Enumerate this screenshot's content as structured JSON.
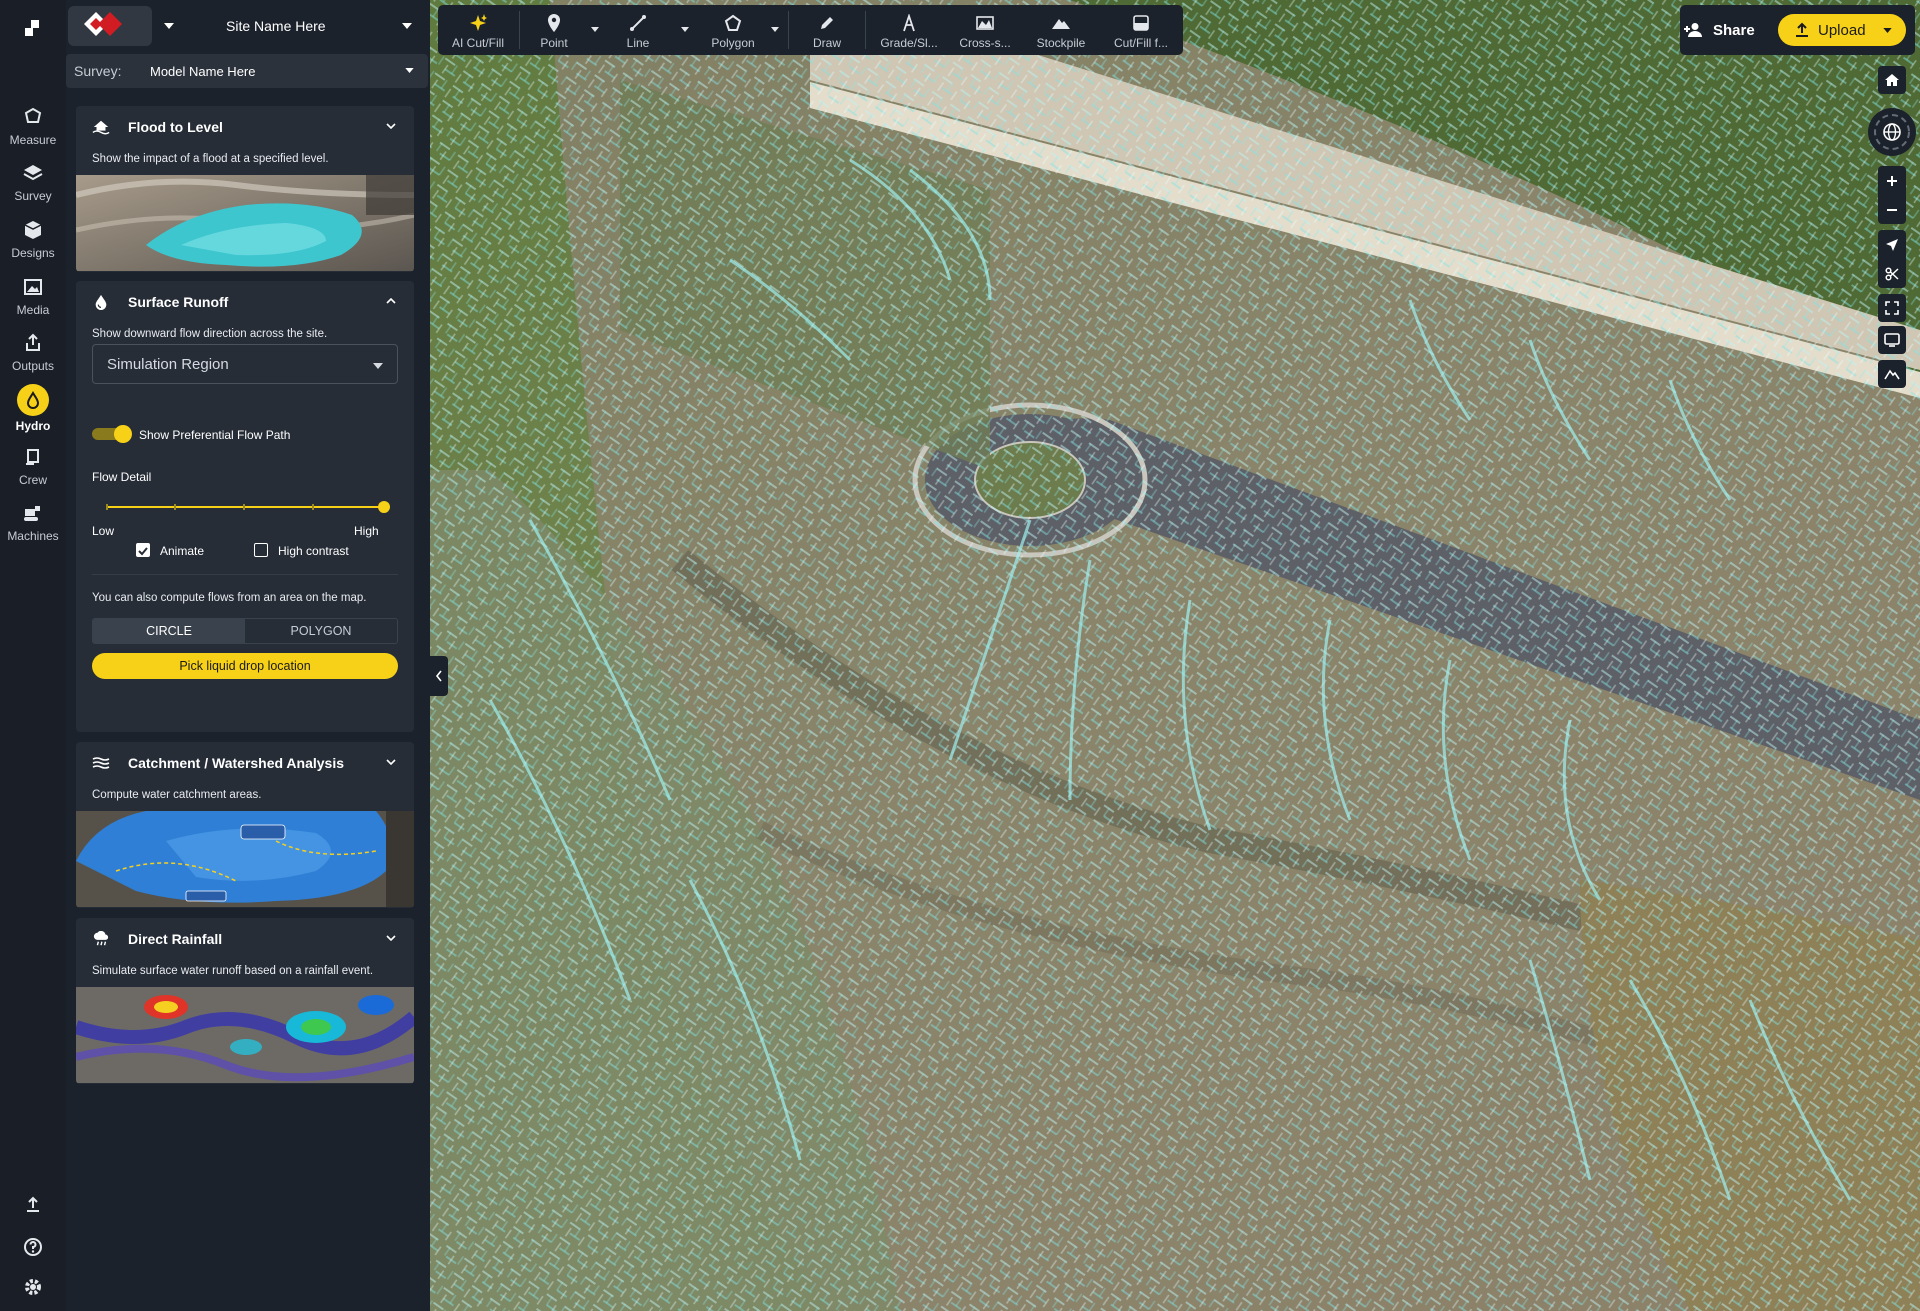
{
  "rail": {
    "items": [
      {
        "label": "Measure",
        "icon": "measure-icon"
      },
      {
        "label": "Survey",
        "icon": "layers-icon"
      },
      {
        "label": "Designs",
        "icon": "cube-icon"
      },
      {
        "label": "Media",
        "icon": "image-icon"
      },
      {
        "label": "Outputs",
        "icon": "export-icon"
      },
      {
        "label": "Hydro",
        "icon": "water-drop-icon",
        "active": true
      },
      {
        "label": "Crew",
        "icon": "crew-icon"
      },
      {
        "label": "Machines",
        "icon": "machine-icon"
      }
    ]
  },
  "header": {
    "site": "Site Name Here",
    "survey_label": "Survey:",
    "survey_value": "Model Name Here"
  },
  "cards": {
    "flood": {
      "title": "Flood to Level",
      "desc": "Show the impact of a flood at a specified level."
    },
    "runoff": {
      "title": "Surface Runoff",
      "desc": "Show downward flow direction across the site.",
      "region": "Simulation Region",
      "toggle_label": "Show Preferential Flow Path",
      "toggle_on": true,
      "flow_detail_label": "Flow Detail",
      "flow_detail_value": 1.0,
      "low": "Low",
      "high": "High",
      "animate": "Animate",
      "animate_checked": true,
      "high_contrast": "High contrast",
      "high_contrast_checked": false,
      "also": "You can also compute flows from an area on the map.",
      "seg_circle": "CIRCLE",
      "seg_polygon": "POLYGON",
      "pick": "Pick liquid drop location"
    },
    "catchment": {
      "title": "Catchment / Watershed Analysis",
      "desc": "Compute water catchment areas."
    },
    "rainfall": {
      "title": "Direct Rainfall",
      "desc": "Simulate surface water runoff based on a rainfall event."
    }
  },
  "toolbar": {
    "items": [
      {
        "label": "AI Cut/Fill",
        "icon": "sparkle-icon"
      },
      {
        "label": "Point",
        "icon": "pin-icon"
      },
      {
        "label": "Line",
        "icon": "line-icon"
      },
      {
        "label": "Polygon",
        "icon": "polygon-icon"
      },
      {
        "label": "Draw",
        "icon": "pencil-icon"
      },
      {
        "label": "Grade/Sl...",
        "icon": "grade-icon"
      },
      {
        "label": "Cross-s...",
        "icon": "cross-section-icon"
      },
      {
        "label": "Stockpile",
        "icon": "stockpile-icon"
      },
      {
        "label": "Cut/Fill f...",
        "icon": "cutfill-icon"
      }
    ]
  },
  "actions": {
    "share": "Share",
    "upload": "Upload"
  },
  "colors": {
    "accent": "#f7d117",
    "panel": "#1c222b",
    "card": "#262d37",
    "flow": "#7fe3e6"
  }
}
